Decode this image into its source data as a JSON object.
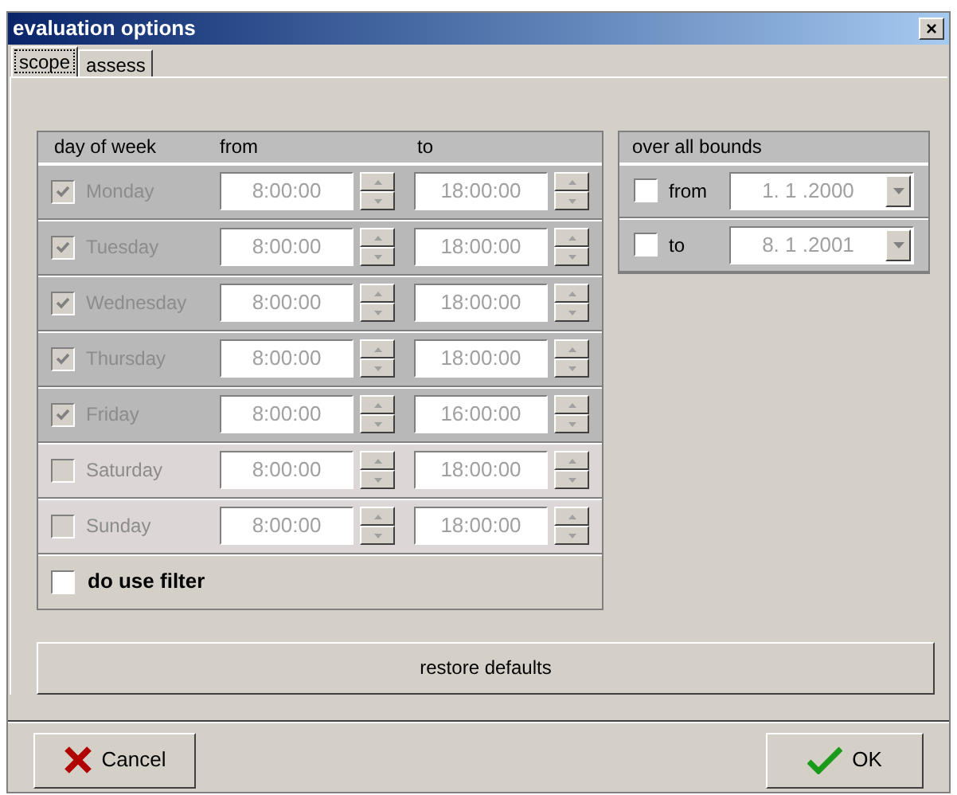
{
  "window": {
    "title": "evaluation options",
    "close": "×"
  },
  "tabs": [
    {
      "label": "scope",
      "selected": true
    },
    {
      "label": "assess",
      "selected": false
    }
  ],
  "schedule": {
    "columns": [
      "day of week",
      "from",
      "to"
    ],
    "days": [
      {
        "name": "Monday",
        "checked": true,
        "disabled": true,
        "from": "8:00:00",
        "to": "18:00:00"
      },
      {
        "name": "Tuesday",
        "checked": true,
        "disabled": true,
        "from": "8:00:00",
        "to": "18:00:00"
      },
      {
        "name": "Wednesday",
        "checked": true,
        "disabled": true,
        "from": "8:00:00",
        "to": "18:00:00"
      },
      {
        "name": "Thursday",
        "checked": true,
        "disabled": true,
        "from": "8:00:00",
        "to": "18:00:00"
      },
      {
        "name": "Friday",
        "checked": true,
        "disabled": true,
        "from": "8:00:00",
        "to": "16:00:00"
      },
      {
        "name": "Saturday",
        "checked": false,
        "disabled": true,
        "from": "8:00:00",
        "to": "18:00:00"
      },
      {
        "name": "Sunday",
        "checked": false,
        "disabled": true,
        "from": "8:00:00",
        "to": "18:00:00"
      }
    ],
    "filter": {
      "label": "do use filter",
      "checked": false
    }
  },
  "bounds": {
    "title": "over all bounds",
    "rows": [
      {
        "label": "from",
        "checked": false,
        "value": "1. 1 .2000"
      },
      {
        "label": "to",
        "checked": false,
        "value": "8. 1 .2001"
      }
    ]
  },
  "restore_button": "restore defaults",
  "buttons": [
    {
      "kind": "cancel",
      "label": "Cancel"
    },
    {
      "kind": "ok",
      "label": "OK"
    }
  ]
}
